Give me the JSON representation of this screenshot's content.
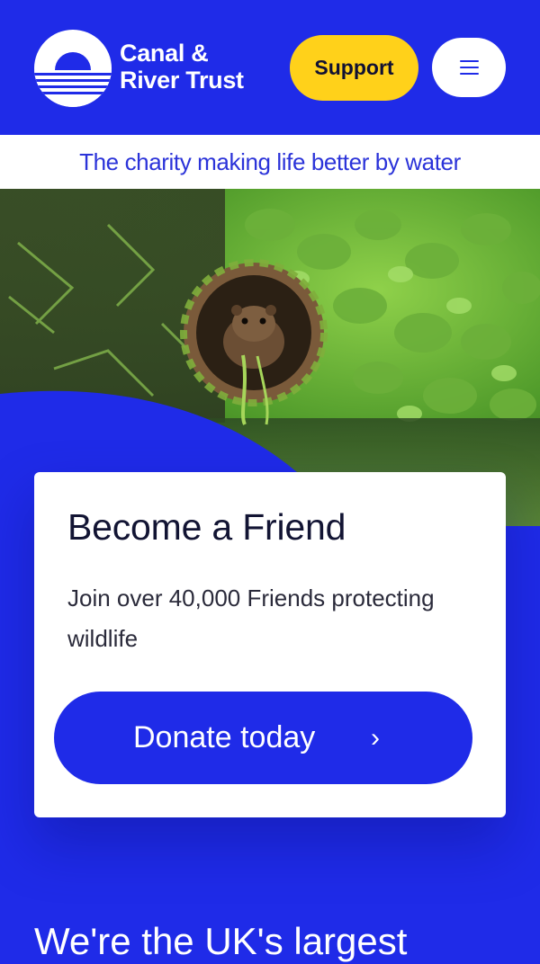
{
  "header": {
    "logo_line1": "Canal &",
    "logo_line2": "River Trust",
    "support_label": "Support",
    "menu_icon": "hamburger-menu-icon"
  },
  "tagline": "The charity making life better by water",
  "hero": {
    "image_subject": "water vole in a mossy pipe",
    "wave_color": "#1f2be8"
  },
  "card": {
    "title": "Become a Friend",
    "text": "Join over 40,000 Friends protecting wildlife",
    "donate_label": "Donate today",
    "donate_icon": "chevron-right-icon"
  },
  "bottom_heading": "We're the UK's largest",
  "colors": {
    "brand_blue": "#1f2be8",
    "support_yellow": "#ffd11a",
    "white": "#ffffff"
  }
}
